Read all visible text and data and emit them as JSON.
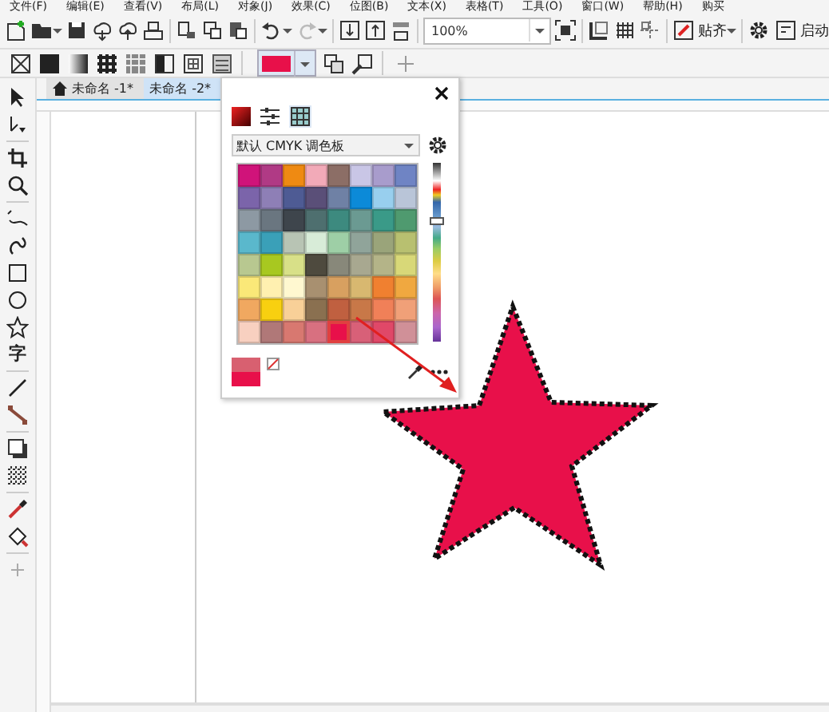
{
  "menu_bar": [
    "文件(F)",
    "编辑(E)",
    "查看(V)",
    "布局(L)",
    "对象(J)",
    "效果(C)",
    "位图(B)",
    "文本(X)",
    "表格(T)",
    "工具(O)",
    "窗口(W)",
    "帮助(H)",
    "购买"
  ],
  "toolbar": {
    "zoom": "100%",
    "snap": "贴齐",
    "launch": "启动"
  },
  "toolbox": {
    "text_tool": "字"
  },
  "tabs": [
    {
      "label": "未命名 -1*",
      "selected": false
    },
    {
      "label": "未命名 -2*",
      "selected": true
    }
  ],
  "docker": {
    "palette_name": "默认 CMYK 调色板",
    "swatches": [
      {
        "color": "#d0137a",
        "selected": false
      },
      {
        "color": "#b03a85",
        "selected": false
      },
      {
        "color": "#ef8a12",
        "selected": false
      },
      {
        "color": "#f2aab8",
        "selected": false
      },
      {
        "color": "#8c6e66",
        "selected": false
      },
      {
        "color": "#c9c6e6",
        "selected": false
      },
      {
        "color": "#a89ccc",
        "selected": false
      },
      {
        "color": "#6f84c4",
        "selected": false
      },
      {
        "color": "#7b64aa",
        "selected": false
      },
      {
        "color": "#8e7fb6",
        "selected": false
      },
      {
        "color": "#4e5b94",
        "selected": false
      },
      {
        "color": "#5a4f78",
        "selected": false
      },
      {
        "color": "#6f81a5",
        "selected": false
      },
      {
        "color": "#0c8ad8",
        "selected": false
      },
      {
        "color": "#98cfee",
        "selected": false
      },
      {
        "color": "#b9c5d8",
        "selected": false
      },
      {
        "color": "#8d99a3",
        "selected": false
      },
      {
        "color": "#6a7680",
        "selected": false
      },
      {
        "color": "#3e454c",
        "selected": false
      },
      {
        "color": "#4e6f6f",
        "selected": false
      },
      {
        "color": "#3d8a7f",
        "selected": false
      },
      {
        "color": "#6b9a92",
        "selected": false
      },
      {
        "color": "#3a9a88",
        "selected": false
      },
      {
        "color": "#4f9a6f",
        "selected": false
      },
      {
        "color": "#5ab8cc",
        "selected": false
      },
      {
        "color": "#3aa0b8",
        "selected": false
      },
      {
        "color": "#b8c4b4",
        "selected": false
      },
      {
        "color": "#d8ecd8",
        "selected": false
      },
      {
        "color": "#9ecfa6",
        "selected": false
      },
      {
        "color": "#90a49a",
        "selected": false
      },
      {
        "color": "#9aa47a",
        "selected": false
      },
      {
        "color": "#b8c070",
        "selected": false
      },
      {
        "color": "#b8c890",
        "selected": false
      },
      {
        "color": "#a8c820",
        "selected": false
      },
      {
        "color": "#d8e088",
        "selected": false
      },
      {
        "color": "#4e4a3e",
        "selected": false
      },
      {
        "color": "#88887a",
        "selected": false
      },
      {
        "color": "#a8a890",
        "selected": false
      },
      {
        "color": "#b4b488",
        "selected": false
      },
      {
        "color": "#d8d878",
        "selected": false
      },
      {
        "color": "#fae878",
        "selected": false
      },
      {
        "color": "#fff0b0",
        "selected": false
      },
      {
        "color": "#fff8d0",
        "selected": false
      },
      {
        "color": "#a89070",
        "selected": false
      },
      {
        "color": "#d8a060",
        "selected": false
      },
      {
        "color": "#d8b870",
        "selected": false
      },
      {
        "color": "#f08030",
        "selected": false
      },
      {
        "color": "#f0a840",
        "selected": false
      },
      {
        "color": "#f0a860",
        "selected": false
      },
      {
        "color": "#f8d010",
        "selected": false
      },
      {
        "color": "#f8d098",
        "selected": false
      },
      {
        "color": "#8a7050",
        "selected": false
      },
      {
        "color": "#c06040",
        "selected": false
      },
      {
        "color": "#c87848",
        "selected": false
      },
      {
        "color": "#f08058",
        "selected": false
      },
      {
        "color": "#f0a078",
        "selected": false
      },
      {
        "color": "#f8d0c0",
        "selected": false
      },
      {
        "color": "#b07878",
        "selected": false
      },
      {
        "color": "#d87870",
        "selected": false
      },
      {
        "color": "#d87080",
        "selected": false
      },
      {
        "color": "#e8104a",
        "selected": true
      },
      {
        "color": "#d86078",
        "selected": false
      },
      {
        "color": "#e04868",
        "selected": false
      },
      {
        "color": "#d09098",
        "selected": false
      }
    ],
    "color_compare": [
      {
        "kind": "old",
        "color": "#d86070"
      },
      {
        "kind": "new",
        "color": "#e8104a"
      }
    ]
  }
}
